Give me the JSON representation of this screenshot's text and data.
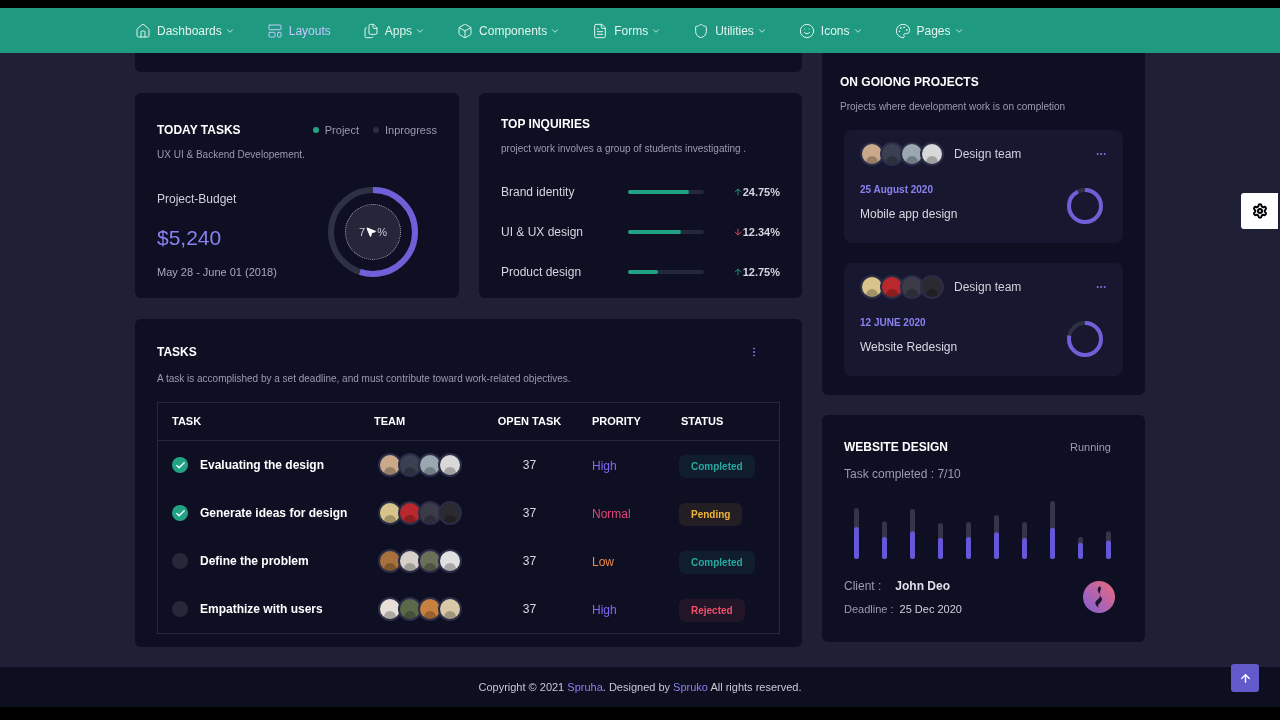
{
  "nav": [
    {
      "label": "Dashboards",
      "selected": false,
      "caret": true
    },
    {
      "label": "Layouts",
      "selected": true,
      "caret": false
    },
    {
      "label": "Apps",
      "selected": false,
      "caret": true
    },
    {
      "label": "Components",
      "selected": false,
      "caret": true
    },
    {
      "label": "Forms",
      "selected": false,
      "caret": true
    },
    {
      "label": "Utilities",
      "selected": false,
      "caret": true
    },
    {
      "label": "Icons",
      "selected": false,
      "caret": true
    },
    {
      "label": "Pages",
      "selected": false,
      "caret": true
    }
  ],
  "today_tasks": {
    "title": "TODAY TASKS",
    "subtitle": "UX UI & Backend Developement.",
    "legend": [
      {
        "label": "Project",
        "color": "#22a584"
      },
      {
        "label": "Inprogress",
        "color": "#2a2c40"
      }
    ],
    "budget_label": "Project-Budget",
    "budget": "$5,240",
    "period": "May 28 - June 01 (2018)",
    "donut": {
      "label_start": "7",
      "label_end": "%"
    }
  },
  "top_inquiries": {
    "title": "TOP INQUIRIES",
    "subtitle": "project work involves a group of students investigating .",
    "items": [
      {
        "label": "Brand identity",
        "level": 0.8,
        "kind": "up",
        "value": "24.75%"
      },
      {
        "label": "UI & UX design",
        "level": 0.7,
        "kind": "down",
        "value": "12.34%"
      },
      {
        "label": "Product design",
        "level": 0.4,
        "kind": "up",
        "value": "12.75%"
      }
    ]
  },
  "tasks": {
    "title": "TASKS",
    "subtitle": "A task is accomplished by a set deadline, and must contribute toward work-related objectives.",
    "columns": [
      "TASK",
      "TEAM",
      "OPEN TASK",
      "PRORITY",
      "STATUS"
    ],
    "rows": [
      {
        "task": "Evaluating the design",
        "checked": true,
        "open": "37",
        "priority": {
          "text": "High",
          "color": "#7e6cf0"
        },
        "status": {
          "text": "Completed",
          "color": "#2aa8a0"
        }
      },
      {
        "task": "Generate ideas for design",
        "checked": true,
        "open": "37",
        "priority": {
          "text": "Normal",
          "color": "#e0447a"
        },
        "status": {
          "text": "Pending",
          "color": "#f0b43a"
        }
      },
      {
        "task": "Define the problem",
        "checked": false,
        "open": "37",
        "priority": {
          "text": "Low",
          "color": "#f08a4a"
        },
        "status": {
          "text": "Completed",
          "color": "#2aa8a0"
        }
      },
      {
        "task": "Empathize with users",
        "checked": false,
        "open": "37",
        "priority": {
          "text": "High",
          "color": "#7e6cf0"
        },
        "status": {
          "text": "Rejected",
          "color": "#f0506a"
        }
      }
    ]
  },
  "ongoing": {
    "title": "ON GOIONG PROJECTS",
    "subtitle": "Projects where development work is on completion",
    "projects": [
      {
        "team_label": "Design team",
        "date": "25 August 2020",
        "name": "Mobile app design"
      },
      {
        "team_label": "Design team",
        "date": "12 JUNE 2020",
        "name": "Website Redesign"
      }
    ]
  },
  "website_design": {
    "title": "WEBSITE DESIGN",
    "state": "Running",
    "progress": "Task completed : 7/10",
    "client_label": "Client :",
    "client": "John Deo",
    "deadline_label": "Deadline :",
    "deadline": "25 Dec 2020"
  },
  "footer": {
    "prefix": "Copyright © 2021 ",
    "brand": "Spruha",
    "middle": ". Designed by ",
    "author": "Spruko",
    "suffix": " All rights reserved."
  }
}
